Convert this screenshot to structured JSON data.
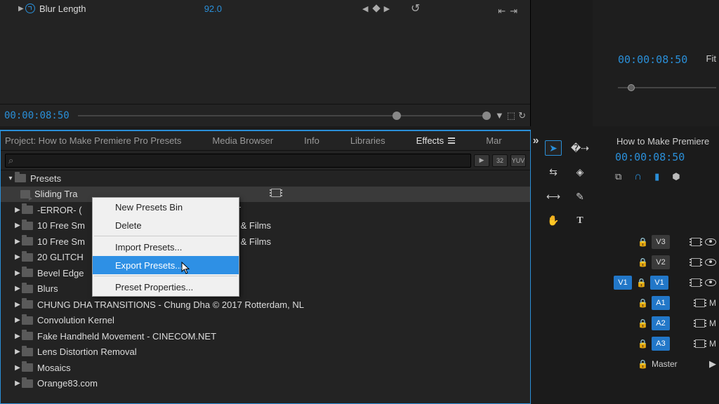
{
  "effectControls": {
    "paramName": "Blur Length",
    "paramValue": "92.0",
    "timecode": "00:00:08:50"
  },
  "programMonitor": {
    "timecode": "00:00:08:50",
    "zoom": "Fit"
  },
  "projectPanel": {
    "tabs": {
      "project": "Project: How to Make Premiere Pro Presets",
      "media": "Media Browser",
      "info": "Info",
      "libraries": "Libraries",
      "effects": "Effects",
      "markers": "Mar"
    },
    "chips": {
      "a": "▶",
      "b": "32",
      "c": "YUV"
    },
    "root": "Presets",
    "items": [
      {
        "label": "Sliding Tra",
        "sel": true,
        "extra": true
      },
      {
        "label": "-ERROR- (",
        "tailA": "ET"
      },
      {
        "label": "10 Free Sm",
        "tailA": "el & Films"
      },
      {
        "label": "10 Free Sm",
        "tailA": "el & Films"
      },
      {
        "label": "20 GLITCH"
      },
      {
        "label": "Bevel Edge"
      },
      {
        "label": "Blurs"
      },
      {
        "label": "CHUNG DHA TRANSITIONS - Chung Dha © 2017 Rotterdam, NL"
      },
      {
        "label": "Convolution Kernel"
      },
      {
        "label": "Fake Handheld Movement - CINECOM.NET"
      },
      {
        "label": "Lens Distortion Removal"
      },
      {
        "label": "Mosaics"
      },
      {
        "label": "Orange83.com"
      }
    ]
  },
  "contextMenu": {
    "newBin": "New Presets Bin",
    "delete": "Delete",
    "import": "Import Presets...",
    "export": "Export Presets...",
    "props": "Preset Properties..."
  },
  "timeline": {
    "sequence": "How to Make Premiere",
    "timecode": "00:00:08:50",
    "tracks": {
      "v3": "V3",
      "v2": "V2",
      "v1": "V1",
      "a1": "A1",
      "a2": "A2",
      "a3": "A3",
      "master": "Master",
      "src_v1": "V1",
      "m": "M"
    }
  }
}
